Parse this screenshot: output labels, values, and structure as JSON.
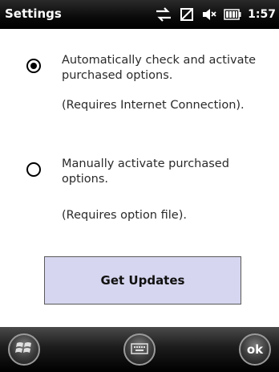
{
  "titlebar": {
    "title": "Settings",
    "clock": "1:57",
    "icons": [
      "connectivity-icon",
      "signal-off-icon",
      "speaker-muted-icon",
      "battery-icon"
    ]
  },
  "options": [
    {
      "selected": true,
      "label": "Automatically check and activate purchased options.",
      "note": "(Requires Internet Connection)."
    },
    {
      "selected": false,
      "label": "Manually activate purchased options.",
      "note": "(Requires option file)."
    }
  ],
  "update_button": {
    "label": "Get Updates"
  },
  "softkeys": {
    "start_icon": "windows-flag-icon",
    "keyboard_icon": "keyboard-icon",
    "ok_label": "ok"
  },
  "colors": {
    "button_bg": "#d6d6f0",
    "bar_bg": "#000000"
  }
}
